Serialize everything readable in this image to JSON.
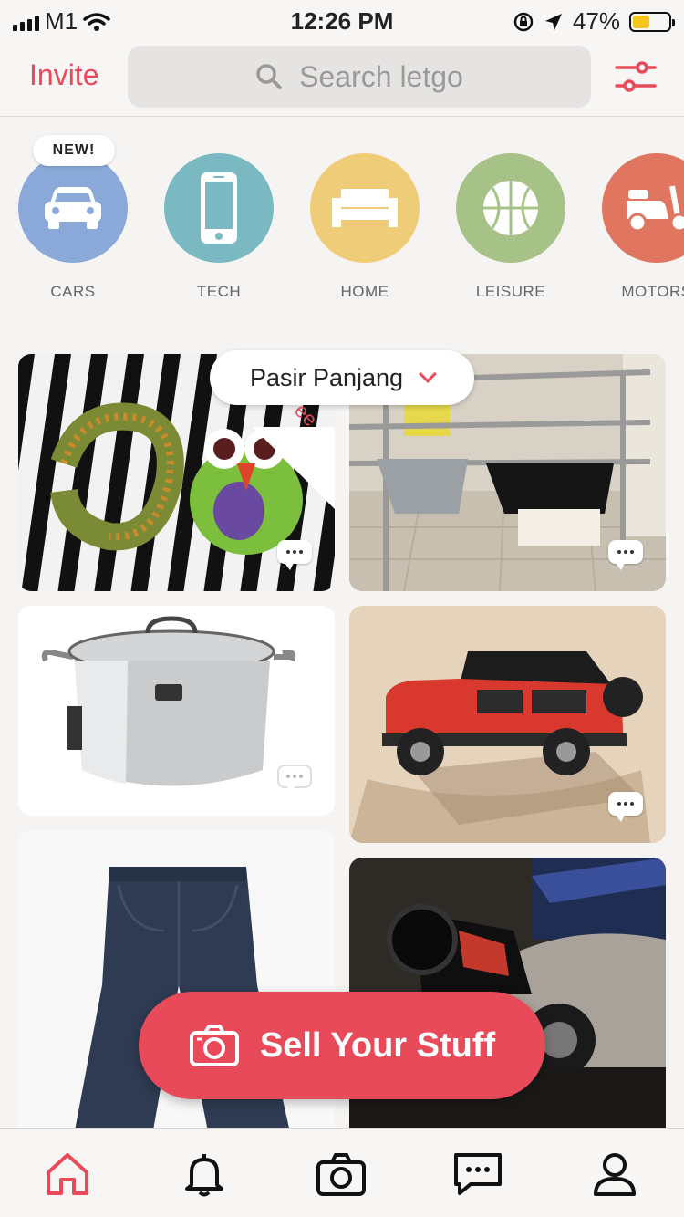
{
  "status_bar": {
    "carrier": "M1",
    "time": "12:26 PM",
    "battery_pct": "47%",
    "battery_level": 0.47
  },
  "header": {
    "invite_label": "Invite",
    "search_placeholder": "Search letgo"
  },
  "categories": [
    {
      "label": "CARS",
      "color": "#8aa9d8",
      "badge": "NEW!"
    },
    {
      "label": "TECH",
      "color": "#7ab8c2"
    },
    {
      "label": "HOME",
      "color": "#efcd78"
    },
    {
      "label": "LEISURE",
      "color": "#a6c287"
    },
    {
      "label": "MOTORS",
      "color": "#e07560"
    }
  ],
  "location": {
    "label": "Pasir Panjang"
  },
  "listings": [
    {
      "name": "Beaded bracelet and owl plush",
      "tag": "ee"
    },
    {
      "name": "Drying rack"
    },
    {
      "name": "Stainless stock pot"
    },
    {
      "name": "Red toy SUV"
    },
    {
      "name": "Blue jeans"
    },
    {
      "name": "Motorbike"
    }
  ],
  "sell_button": {
    "label": "Sell Your Stuff"
  },
  "colors": {
    "accent": "#e84a5a"
  }
}
